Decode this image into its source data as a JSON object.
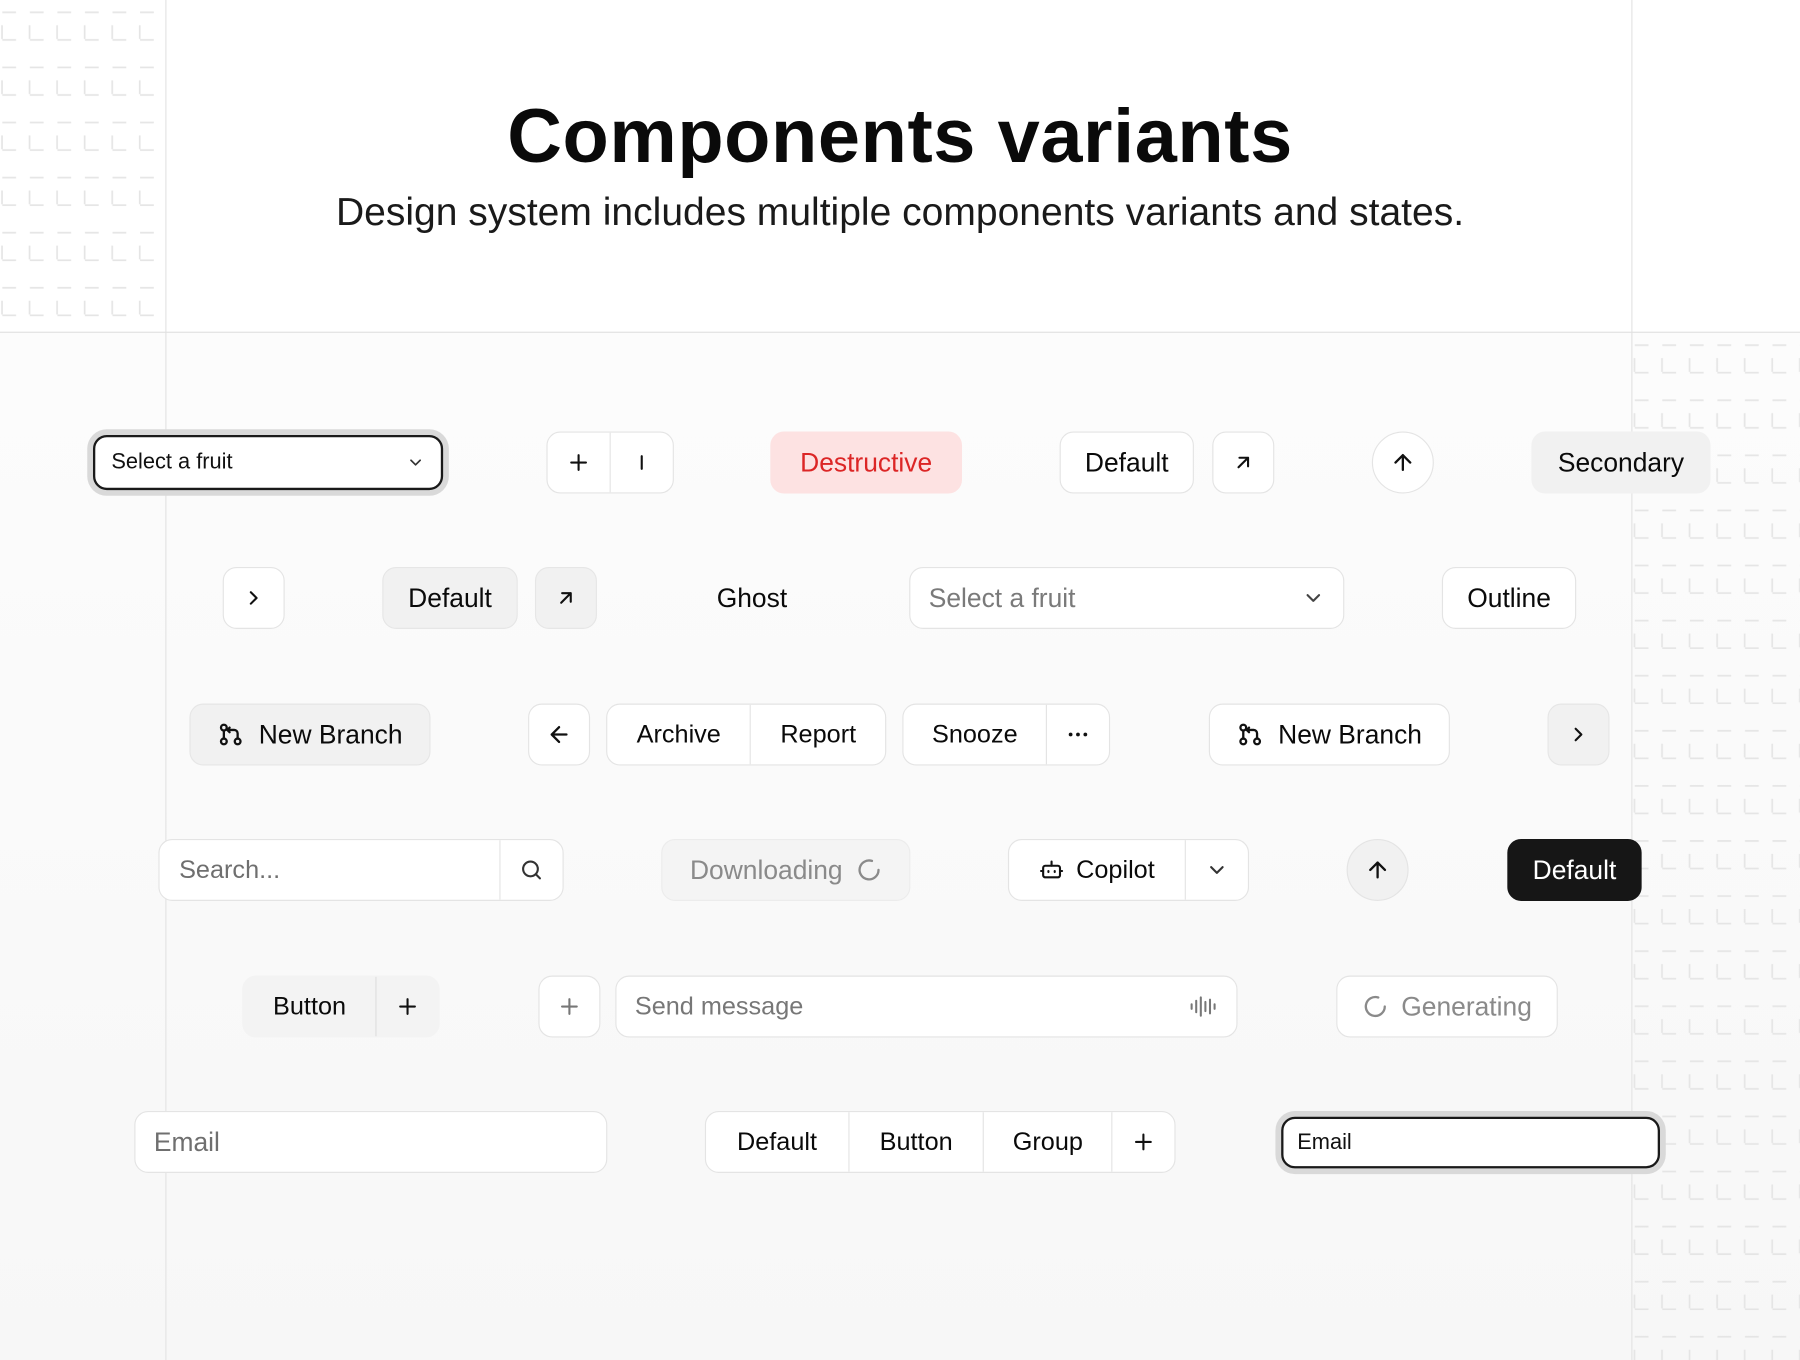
{
  "header": {
    "title": "Components variants",
    "subtitle": "Design system includes multiple components variants and states."
  },
  "row1": {
    "select_value": "Select a fruit",
    "destructive_label": "Destructive",
    "default_label": "Default",
    "secondary_label": "Secondary"
  },
  "row2": {
    "default_label": "Default",
    "ghost_label": "Ghost",
    "select_placeholder": "Select a fruit",
    "outline_label": "Outline"
  },
  "row3": {
    "new_branch_label": "New Branch",
    "archive_label": "Archive",
    "report_label": "Report",
    "snooze_label": "Snooze",
    "new_branch_label_2": "New Branch"
  },
  "row4": {
    "search_placeholder": "Search...",
    "downloading_label": "Downloading",
    "copilot_label": "Copilot",
    "default_label": "Default"
  },
  "row5": {
    "button_label": "Button",
    "message_placeholder": "Send message",
    "generating_label": "Generating"
  },
  "row6": {
    "email_placeholder": "Email",
    "group_labels": [
      "Default",
      "Button",
      "Group"
    ],
    "email_value": "Email"
  },
  "icons": [
    "plus-icon",
    "text-cursor-icon",
    "arrow-up-right-icon",
    "arrow-up-icon",
    "chevron-right-icon",
    "chevron-down-icon",
    "git-branch-icon",
    "arrow-left-icon",
    "more-horizontal-icon",
    "search-icon",
    "loader-icon",
    "bot-icon",
    "audio-waveform-icon"
  ],
  "colors": {
    "destructive_bg": "#fde2e2",
    "destructive_text": "#dc2626",
    "dark_bg": "#161616",
    "border": "#e4e4e4"
  }
}
